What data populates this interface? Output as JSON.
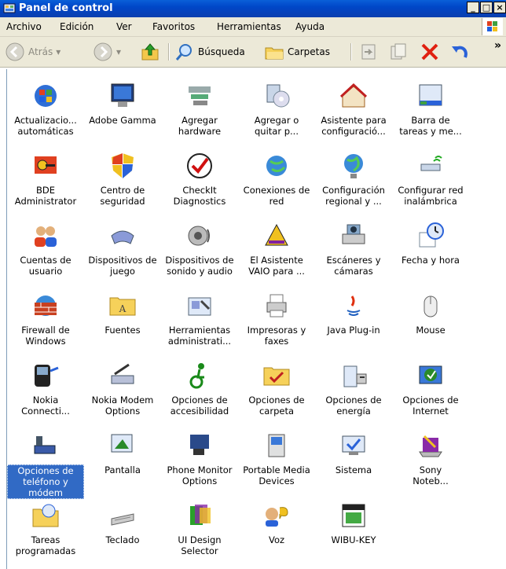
{
  "window": {
    "title": "Panel de control"
  },
  "caption_buttons": [
    "_",
    "□",
    "×"
  ],
  "menu": [
    "Archivo",
    "Edición",
    "Ver",
    "Favoritos",
    "Herramientas",
    "Ayuda"
  ],
  "toolbar": {
    "back": "Atrás",
    "search": "Búsqueda",
    "folders": "Carpetas",
    "more": "»"
  },
  "items": [
    {
      "label": "Actualizacio...\nautomáticas",
      "icon": "windows-update-icon"
    },
    {
      "label": "Adobe Gamma",
      "icon": "monitor-icon"
    },
    {
      "label": "Agregar\nhardware",
      "icon": "add-hardware-icon"
    },
    {
      "label": "Agregar o\nquitar p...",
      "icon": "add-remove-programs-icon"
    },
    {
      "label": "Asistente para\nconfiguració...",
      "icon": "network-wizard-icon"
    },
    {
      "label": "Barra de\ntareas y me...",
      "icon": "taskbar-icon"
    },
    {
      "label": "BDE\nAdministrator",
      "icon": "bde-admin-icon"
    },
    {
      "label": "Centro de\nseguridad",
      "icon": "security-center-icon"
    },
    {
      "label": "CheckIt\nDiagnostics",
      "icon": "checkit-icon"
    },
    {
      "label": "Conexiones de\nred",
      "icon": "network-connections-icon"
    },
    {
      "label": "Configuración\nregional y ...",
      "icon": "regional-settings-icon"
    },
    {
      "label": "Configurar red\ninalámbrica",
      "icon": "wireless-network-icon"
    },
    {
      "label": "Cuentas de\nusuario",
      "icon": "user-accounts-icon"
    },
    {
      "label": "Dispositivos de\njuego",
      "icon": "game-controllers-icon"
    },
    {
      "label": "Dispositivos de\nsonido y audio",
      "icon": "sound-devices-icon"
    },
    {
      "label": "El Asistente\nVAIO para ...",
      "icon": "vaio-assistant-icon"
    },
    {
      "label": "Escáneres y\ncámaras",
      "icon": "scanners-cameras-icon"
    },
    {
      "label": "Fecha y hora",
      "icon": "date-time-icon"
    },
    {
      "label": "Firewall de\nWindows",
      "icon": "firewall-icon"
    },
    {
      "label": "Fuentes",
      "icon": "fonts-folder-icon"
    },
    {
      "label": "Herramientas\nadministrati...",
      "icon": "admin-tools-icon"
    },
    {
      "label": "Impresoras y\nfaxes",
      "icon": "printers-icon"
    },
    {
      "label": "Java Plug-in",
      "icon": "java-icon"
    },
    {
      "label": "Mouse",
      "icon": "mouse-icon"
    },
    {
      "label": "Nokia\nConnecti...",
      "icon": "nokia-connectivity-icon"
    },
    {
      "label": "Nokia Modem\nOptions",
      "icon": "nokia-modem-icon"
    },
    {
      "label": "Opciones de\naccesibilidad",
      "icon": "accessibility-icon"
    },
    {
      "label": "Opciones de\ncarpeta",
      "icon": "folder-options-icon"
    },
    {
      "label": "Opciones de\nenergía",
      "icon": "power-options-icon"
    },
    {
      "label": "Opciones de\nInternet",
      "icon": "internet-options-icon"
    },
    {
      "label": "Opciones de\nteléfono y\nmódem",
      "icon": "phone-modem-icon",
      "selected": true
    },
    {
      "label": "Pantalla",
      "icon": "display-icon"
    },
    {
      "label": "Phone Monitor\nOptions",
      "icon": "phone-monitor-icon"
    },
    {
      "label": "Portable Media\nDevices",
      "icon": "portable-media-icon"
    },
    {
      "label": "Sistema",
      "icon": "system-icon"
    },
    {
      "label": "Sony\nNoteb...",
      "icon": "sony-notebook-icon"
    },
    {
      "label": "Tareas\nprogramadas",
      "icon": "scheduled-tasks-icon"
    },
    {
      "label": "Teclado",
      "icon": "keyboard-icon"
    },
    {
      "label": "UI Design\nSelector",
      "icon": "ui-design-selector-icon"
    },
    {
      "label": "Voz",
      "icon": "speech-icon"
    },
    {
      "label": "WIBU-KEY",
      "icon": "wibu-key-icon"
    }
  ]
}
